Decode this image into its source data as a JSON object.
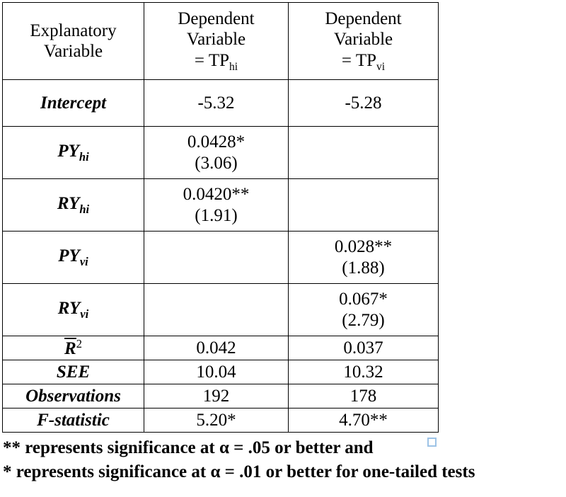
{
  "table": {
    "headers": [
      {
        "lines": [
          "Explanatory",
          "Variable"
        ]
      },
      {
        "lines": [
          "Dependent",
          "Variable"
        ],
        "equals": "= TP",
        "subscript": "hi"
      },
      {
        "lines": [
          "Dependent",
          "Variable"
        ],
        "equals": "= TP",
        "subscript": "vi"
      }
    ],
    "rows": [
      {
        "label": "Intercept",
        "label_base": "Intercept",
        "label_sub": "",
        "col2": {
          "coefficient": "-5.32",
          "tstat": ""
        },
        "col3": {
          "coefficient": "-5.28",
          "tstat": ""
        }
      },
      {
        "label": "PYhi",
        "label_base": "PY",
        "label_sub": "hi",
        "col2": {
          "coefficient": "0.0428*",
          "tstat": "(3.06)"
        },
        "col3": {
          "coefficient": "",
          "tstat": ""
        }
      },
      {
        "label": "RYhi",
        "label_base": "RY",
        "label_sub": "hi",
        "col2": {
          "coefficient": "0.0420**",
          "tstat": "(1.91)"
        },
        "col3": {
          "coefficient": "",
          "tstat": ""
        }
      },
      {
        "label": "PYvi",
        "label_base": "PY",
        "label_sub": "vi",
        "col2": {
          "coefficient": "",
          "tstat": ""
        },
        "col3": {
          "coefficient": "0.028**",
          "tstat": "(1.88)"
        }
      },
      {
        "label": "RYvi",
        "label_base": "RY",
        "label_sub": "vi",
        "col2": {
          "coefficient": "",
          "tstat": ""
        },
        "col3": {
          "coefficient": "0.067*",
          "tstat": "(2.79)"
        }
      }
    ],
    "summary_rows": [
      {
        "label_base": "R",
        "label_sup": "2",
        "col2": "0.042",
        "col3": "0.037"
      },
      {
        "label_base": "SEE",
        "label_sup": "",
        "col2": "10.04",
        "col3": "10.32"
      },
      {
        "label_base": "Observations",
        "label_sup": "",
        "col2": "192",
        "col3": "178"
      },
      {
        "label_base": "F-statistic",
        "label_sup": "",
        "col2": "5.20*",
        "col3": "4.70**"
      }
    ]
  },
  "footnotes": [
    "** represents significance at α = .05 or better and",
    "* represents significance at α = .01 or better for one-tailed tests"
  ],
  "colors": {
    "text": "#000000",
    "border": "#000000",
    "background": "#ffffff",
    "handle_border": "#9dc3e6"
  }
}
